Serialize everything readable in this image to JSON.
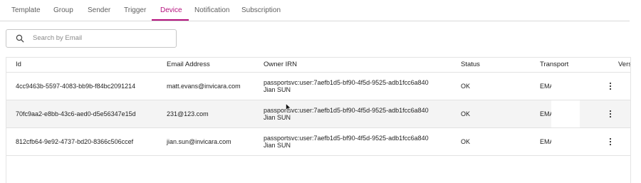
{
  "tabs": [
    {
      "label": "Template"
    },
    {
      "label": "Group"
    },
    {
      "label": "Sender"
    },
    {
      "label": "Trigger"
    },
    {
      "label": "Device"
    },
    {
      "label": "Notification"
    },
    {
      "label": "Subscription"
    }
  ],
  "active_tab": "Device",
  "search": {
    "placeholder": "Search by Email"
  },
  "table": {
    "headers": {
      "id": "Id",
      "email": "Email Address",
      "owner": "Owner IRN",
      "status": "Status",
      "transport": "Transport",
      "version": "Vers"
    },
    "rows": [
      {
        "id": "4cc9463b-5597-4083-bb9b-f84bc2091214",
        "email": "matt.evans@invicara.com",
        "owner_irn": "passportsvc:user:7aefb1d5-bf90-4f5d-9525-adb1fcc6a840",
        "owner_name": "Jian SUN",
        "status": "OK",
        "transport": "EMAIL"
      },
      {
        "id": "70fc9aa2-e8bb-43c6-aed0-d5e56347e15d",
        "email": "231@123.com",
        "owner_irn": "passportsvc:user:7aefb1d5-bf90-4f5d-9525-adb1fcc6a840",
        "owner_name": "Jian SUN",
        "status": "OK",
        "transport": "EMAIL"
      },
      {
        "id": "812cfb64-9e92-4737-bd20-8366c506ccef",
        "email": "jian.sun@invicara.com",
        "owner_irn": "passportsvc:user:7aefb1d5-bf90-4f5d-9525-adb1fcc6a840",
        "owner_name": "Jian SUN",
        "status": "OK",
        "transport": "EMAIL"
      }
    ]
  },
  "icons": {
    "search": "search-icon",
    "row_menu": "more-vertical-icon",
    "cursor": "mouse-pointer-icon"
  },
  "colors": {
    "accent": "#b5127e",
    "hover_row": "#f4f4f4"
  }
}
